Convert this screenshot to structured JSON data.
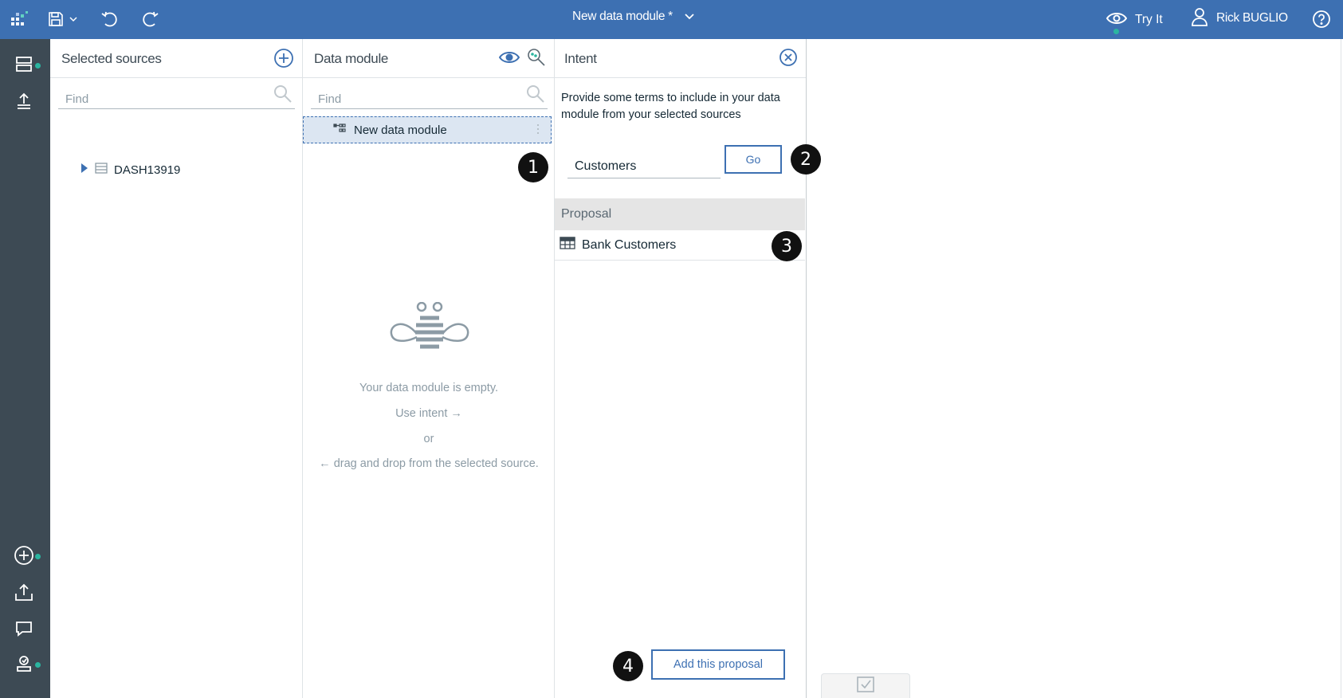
{
  "app": {
    "title": "New data module *",
    "try_it_label": "Try It",
    "user_name": "Rick BUGLIO"
  },
  "icons": {
    "app_logo": "app-logo-icon",
    "save": "save-icon",
    "undo": "undo-icon",
    "redo": "redo-icon",
    "eye": "eye-icon",
    "user": "user-icon",
    "help": "help-icon"
  },
  "colors": {
    "brand": "#3d70b2",
    "rail": "#3d4a54",
    "status_dot": "#2bb5a0",
    "selected_row": "#dce6f2"
  },
  "sources_panel": {
    "title": "Selected sources",
    "find_placeholder": "Find",
    "tree": [
      {
        "label": "DASH13919"
      }
    ]
  },
  "module_panel": {
    "title": "Data module",
    "find_placeholder": "Find",
    "root_item": "New data module",
    "empty_text": {
      "line1": "Your data module is empty.",
      "line2": "Use intent →",
      "line3": "or",
      "line4": "← drag and drop from the selected source."
    }
  },
  "intent_panel": {
    "title": "Intent",
    "description": "Provide some terms to include in your data module from your selected sources",
    "input_value": "Customers",
    "go_label": "Go",
    "proposal_header": "Proposal",
    "proposals": [
      {
        "label": "Bank Customers"
      }
    ],
    "add_label": "Add this proposal"
  },
  "callouts": {
    "one": "1",
    "two": "2",
    "three": "3",
    "four": "4"
  }
}
